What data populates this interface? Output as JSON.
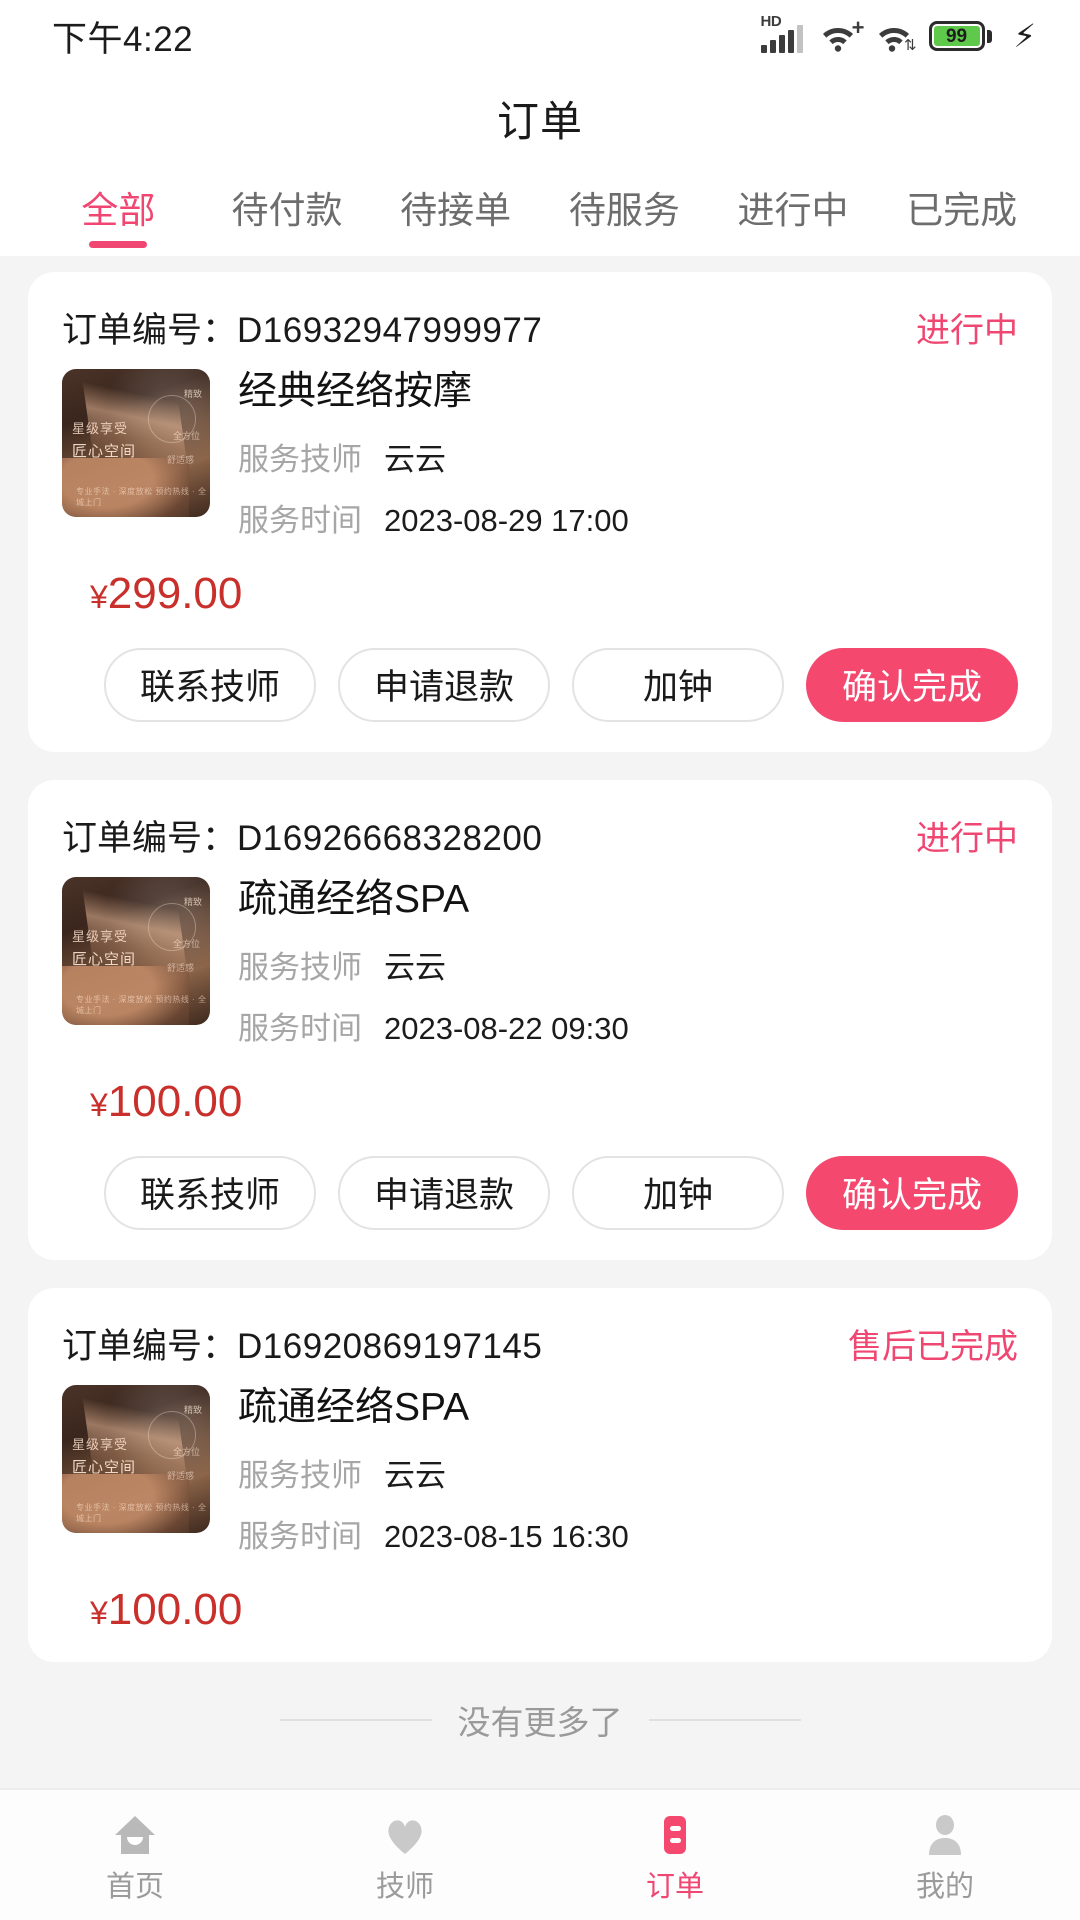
{
  "status_bar": {
    "time": "下午4:22",
    "hd_label": "HD",
    "battery_level": "99",
    "icons": [
      "hd-signal-icon",
      "wifi-plus-icon",
      "wifi-transfer-icon",
      "battery-icon",
      "charging-bolt-icon"
    ]
  },
  "header": {
    "title": "订单"
  },
  "tabs": [
    {
      "label": "全部",
      "active": true
    },
    {
      "label": "待付款",
      "active": false
    },
    {
      "label": "待接单",
      "active": false
    },
    {
      "label": "待服务",
      "active": false
    },
    {
      "label": "进行中",
      "active": false
    },
    {
      "label": "已完成",
      "active": false
    }
  ],
  "labels": {
    "order_no": "订单编号：",
    "technician": "服务技师",
    "service_time": "服务时间",
    "currency": "¥"
  },
  "orders": [
    {
      "order_no": "D16932947999977",
      "status": "进行中",
      "service_name": "经典经络按摩",
      "technician": "云云",
      "service_time": "2023-08-29 17:00",
      "price": "299.00",
      "buttons": [
        {
          "label": "联系技师",
          "style": "ghost"
        },
        {
          "label": "申请退款",
          "style": "ghost"
        },
        {
          "label": "加钟",
          "style": "ghost"
        },
        {
          "label": "确认完成",
          "style": "primary"
        }
      ]
    },
    {
      "order_no": "D16926668328200",
      "status": "进行中",
      "service_name": "疏通经络SPA",
      "technician": "云云",
      "service_time": "2023-08-22 09:30",
      "price": "100.00",
      "buttons": [
        {
          "label": "联系技师",
          "style": "ghost"
        },
        {
          "label": "申请退款",
          "style": "ghost"
        },
        {
          "label": "加钟",
          "style": "ghost"
        },
        {
          "label": "确认完成",
          "style": "primary"
        }
      ]
    },
    {
      "order_no": "D16920869197145",
      "status": "售后已完成",
      "service_name": "疏通经络SPA",
      "technician": "云云",
      "service_time": "2023-08-15 16:30",
      "price": "100.00",
      "buttons": []
    }
  ],
  "thumbnail_overlay": {
    "line1": "星级享受",
    "line2": "匠心空间",
    "corner1": "精致",
    "corner2": "全方位",
    "corner3": "舒适感",
    "bottom": "专业手法 · 深度放松\n预约热线 · 全城上门"
  },
  "list_footer": {
    "text": "没有更多了"
  },
  "bottom_nav": [
    {
      "label": "首页",
      "icon": "home-icon",
      "active": false
    },
    {
      "label": "技师",
      "icon": "heart-icon",
      "active": false
    },
    {
      "label": "订单",
      "icon": "order-list-icon",
      "active": true
    },
    {
      "label": "我的",
      "icon": "person-icon",
      "active": false
    }
  ],
  "colors": {
    "accent_pink": "#ef4772",
    "primary_button": "#f4486f",
    "price_red": "#c9302c",
    "page_bg": "#f4f4f4",
    "battery_green": "#5ec94b"
  }
}
